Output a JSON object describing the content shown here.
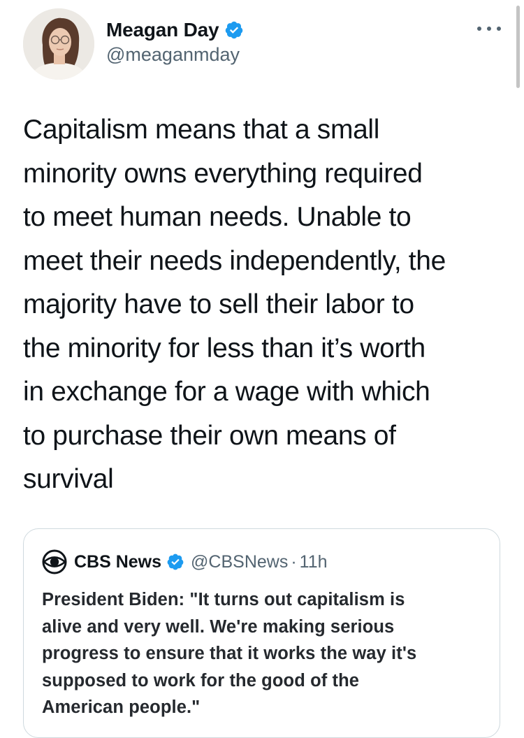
{
  "author": {
    "name": "Meagan Day",
    "handle": "@meaganmday",
    "verified": true,
    "avatar": "profile-photo"
  },
  "tweet": {
    "text": "Capitalism means that a small\nminority owns everything required\nto meet human needs. Unable to\nmeet their needs independently, the\nmajority have to sell their labor to\nthe minority for less than it’s worth\nin exchange for a wage with which\nto purchase their own means of\nsurvival"
  },
  "quoted_tweet": {
    "source_icon": "cbs-eye-logo",
    "name": "CBS News",
    "verified": true,
    "handle": "@CBSNews",
    "separator": "·",
    "time": "11h",
    "text": "President Biden: \"It turns out capitalism is\nalive and very well. We're making serious\nprogress to ensure that it works the way it's\nsupposed to work for the good of the\nAmerican people.\""
  },
  "icons": {
    "verified": "verified-badge-icon",
    "more": "more-options-icon"
  },
  "colors": {
    "text": "#0f1419",
    "secondary": "#536471",
    "verified": "#1d9bf0",
    "border": "#cfd9de"
  }
}
